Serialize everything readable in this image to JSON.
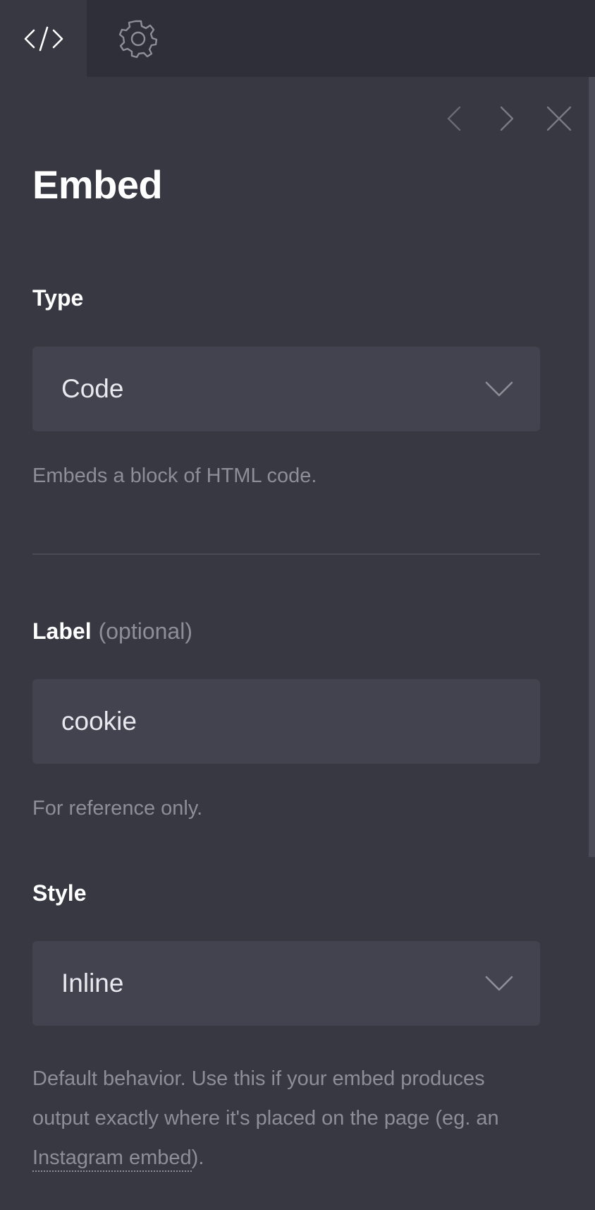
{
  "tabs": [
    {
      "id": "code",
      "icon": "code-icon"
    },
    {
      "id": "settings",
      "icon": "gear-icon"
    }
  ],
  "nav": {
    "prev_icon": "chevron-left-icon",
    "next_icon": "chevron-right-icon",
    "close_icon": "close-icon"
  },
  "panel": {
    "title": "Embed"
  },
  "type_field": {
    "label": "Type",
    "value": "Code",
    "help": "Embeds a block of HTML code."
  },
  "label_field": {
    "label": "Label",
    "optional": "(optional)",
    "value": "cookie",
    "help": "For reference only."
  },
  "style_field": {
    "label": "Style",
    "value": "Inline",
    "help_before": "Default behavior. Use this if your embed produces output exactly where it's placed on the page (eg. an ",
    "help_link": "Instagram embed",
    "help_after": ")."
  },
  "colors": {
    "background": "#383843",
    "topbar": "#2f2f3a",
    "control": "#43434f",
    "text": "#ffffff",
    "muted": "#8e8e99"
  }
}
